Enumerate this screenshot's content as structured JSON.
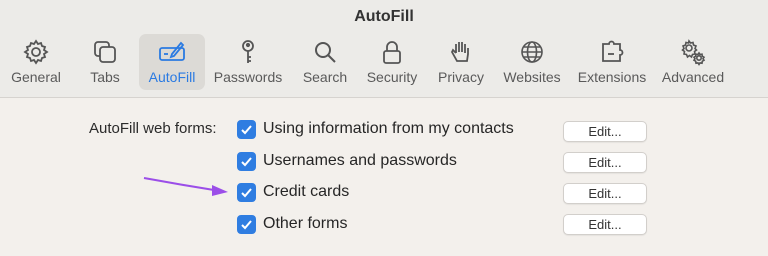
{
  "window": {
    "title": "AutoFill"
  },
  "tabs": [
    {
      "label": "General",
      "icon": "gear-icon"
    },
    {
      "label": "Tabs",
      "icon": "tabs-icon"
    },
    {
      "label": "AutoFill",
      "icon": "autofill-pencil-icon",
      "selected": true
    },
    {
      "label": "Passwords",
      "icon": "key-icon"
    },
    {
      "label": "Search",
      "icon": "magnifier-icon"
    },
    {
      "label": "Security",
      "icon": "lock-icon"
    },
    {
      "label": "Privacy",
      "icon": "hand-icon"
    },
    {
      "label": "Websites",
      "icon": "globe-icon"
    },
    {
      "label": "Extensions",
      "icon": "puzzle-icon"
    },
    {
      "label": "Advanced",
      "icon": "gears-icon"
    }
  ],
  "autofill": {
    "section_label": "AutoFill web forms:",
    "options": [
      {
        "label": "Using information from my contacts",
        "checked": true,
        "button": "Edit..."
      },
      {
        "label": "Usernames and passwords",
        "checked": true,
        "button": "Edit..."
      },
      {
        "label": "Credit cards",
        "checked": true,
        "button": "Edit..."
      },
      {
        "label": "Other forms",
        "checked": true,
        "button": "Edit..."
      }
    ]
  },
  "colors": {
    "accent": "#2f7de1",
    "arrow": "#9b4ee8",
    "selected_tab_text": "#2a7ae2"
  }
}
